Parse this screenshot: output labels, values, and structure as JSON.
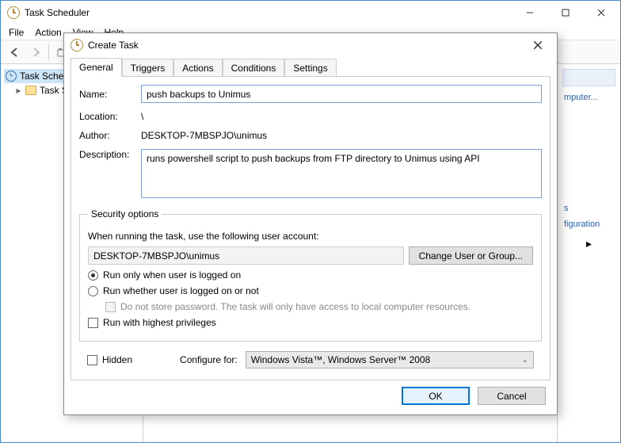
{
  "window": {
    "title": "Task Scheduler",
    "menu": {
      "file": "File",
      "action": "Action",
      "view": "View",
      "help": "Help"
    }
  },
  "tree": {
    "root": "Task Scheduler",
    "child_prefix": "Task S"
  },
  "rightpane_items": [
    "mputer...",
    "s",
    "figuration"
  ],
  "dialog": {
    "title": "Create Task",
    "tabs": {
      "general": "General",
      "triggers": "Triggers",
      "actions": "Actions",
      "conditions": "Conditions",
      "settings": "Settings"
    },
    "labels": {
      "name": "Name:",
      "location": "Location:",
      "author": "Author:",
      "description": "Description:"
    },
    "name_value": "push backups to Unimus",
    "location_value": "\\",
    "author_value": "DESKTOP-7MBSPJO\\unimus",
    "description_value": "runs powershell script to push backups from FTP directory to Unimus using API",
    "security": {
      "legend": "Security options",
      "when_running": "When running the task, use the following user account:",
      "user_account": "DESKTOP-7MBSPJO\\unimus",
      "change_user": "Change User or Group...",
      "run_logged_on": "Run only when user is logged on",
      "run_whether": "Run whether user is logged on or not",
      "do_not_store": "Do not store password.  The task will only have access to local computer resources.",
      "highest_priv": "Run with highest privileges"
    },
    "hidden_label": "Hidden",
    "configure_for_label": "Configure for:",
    "configure_for_value": "Windows Vista™, Windows Server™ 2008",
    "ok": "OK",
    "cancel": "Cancel"
  }
}
